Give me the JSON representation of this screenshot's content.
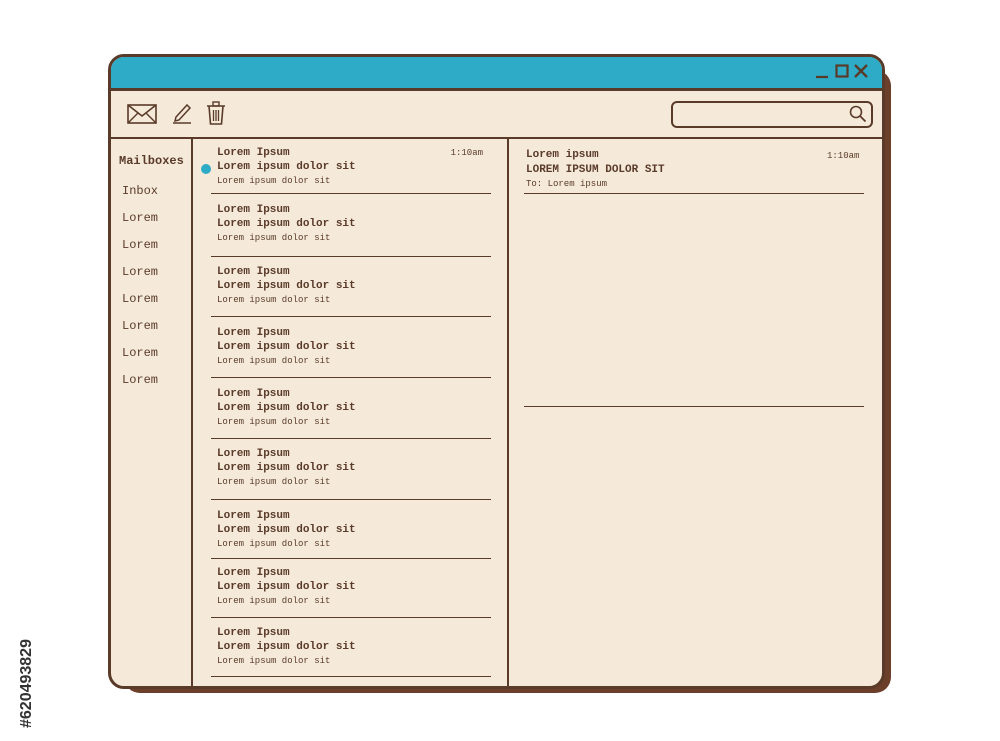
{
  "window": {
    "controls": [
      "minimize-icon",
      "maximize-icon",
      "close-icon"
    ]
  },
  "toolbar": {
    "icons": [
      "mail-icon",
      "compose-icon",
      "trash-icon"
    ],
    "search": {
      "value": "",
      "icon": "search-icon"
    }
  },
  "sidebar": {
    "title": "Mailboxes",
    "items": [
      "Inbox",
      "Lorem",
      "Lorem",
      "Lorem",
      "Lorem",
      "Lorem",
      "Lorem",
      "Lorem"
    ]
  },
  "messages": [
    {
      "sender": "Lorem Ipsum",
      "subject": "Lorem ipsum dolor sit",
      "preview": "Lorem ipsum dolor sit",
      "time": "1:10am",
      "unread": true
    },
    {
      "sender": "Lorem Ipsum",
      "subject": "Lorem ipsum dolor sit",
      "preview": "Lorem ipsum dolor sit"
    },
    {
      "sender": "Lorem Ipsum",
      "subject": "Lorem ipsum dolor sit",
      "preview": "Lorem ipsum dolor sit"
    },
    {
      "sender": "Lorem Ipsum",
      "subject": "Lorem ipsum dolor sit",
      "preview": "Lorem ipsum dolor sit"
    },
    {
      "sender": "Lorem Ipsum",
      "subject": "Lorem ipsum dolor sit",
      "preview": "Lorem ipsum dolor sit"
    },
    {
      "sender": "Lorem Ipsum",
      "subject": "Lorem ipsum dolor sit",
      "preview": "Lorem ipsum dolor sit"
    },
    {
      "sender": "Lorem Ipsum",
      "subject": "Lorem ipsum dolor sit",
      "preview": "Lorem ipsum dolor sit"
    },
    {
      "sender": "Lorem Ipsum",
      "subject": "Lorem ipsum dolor sit",
      "preview": "Lorem ipsum dolor sit"
    },
    {
      "sender": "Lorem Ipsum",
      "subject": "Lorem ipsum dolor sit",
      "preview": "Lorem ipsum dolor sit"
    }
  ],
  "reader": {
    "from": "Lorem ipsum",
    "subject": "LOREM IPSUM DOLOR SIT",
    "to": "To: Lorem ipsum",
    "time": "1:10am"
  },
  "watermark": "#620493829",
  "colors": {
    "accent": "#2eabc6",
    "outline": "#5a3a29",
    "background": "#f5ead9",
    "shadow": "#6b3f2a"
  }
}
